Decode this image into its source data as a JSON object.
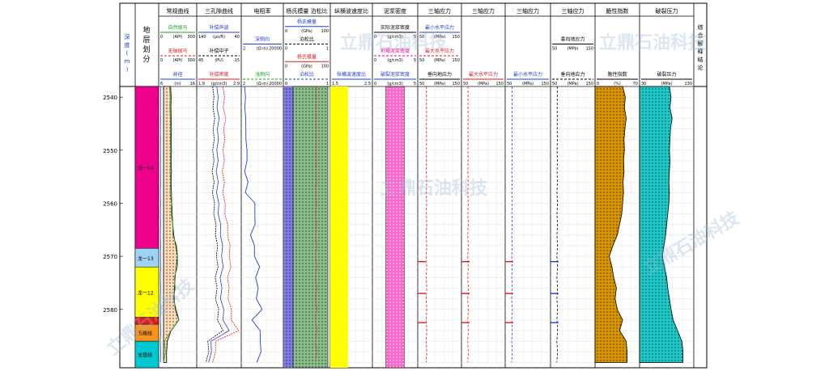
{
  "chart_data": {
    "type": "well-log",
    "depth_track": {
      "title": "深度(m)",
      "ticks": [
        2540,
        2550,
        2560,
        2570,
        2580
      ],
      "ylim": [
        2538,
        2591
      ]
    },
    "zone_track": {
      "title": "地层划分",
      "zones": [
        {
          "name": "龙一14",
          "top": 2538,
          "bottom": 2568.5,
          "color": "#ec008c"
        },
        {
          "name": "龙一13",
          "top": 2568.5,
          "bottom": 2572,
          "color": "#9fd3f5"
        },
        {
          "name": "龙一12",
          "top": 2572,
          "bottom": 2581.5,
          "color": "#ffff00"
        },
        {
          "name": "",
          "top": 2581.5,
          "bottom": 2582.8,
          "color": "#e31a1c"
        },
        {
          "name": "五峰组",
          "top": 2582.8,
          "bottom": 2586,
          "color": "#f7941d"
        },
        {
          "name": "宝塔组",
          "top": 2586,
          "bottom": 2591,
          "color": "#00c8d0"
        }
      ]
    },
    "tracks": [
      {
        "title": "常规曲线",
        "curves": [
          {
            "name": "自然伽马",
            "unit": "(API)",
            "min": "0",
            "max": "300",
            "color": "#2aa02a"
          },
          {
            "name": "无铀伽马",
            "unit": "(API)",
            "min": "0",
            "max": "300",
            "color": "#e31a1c"
          },
          {
            "name": "井径",
            "unit": "(in)",
            "min": "6",
            "max": "16",
            "color": "#1f3fd6"
          }
        ]
      },
      {
        "title": "三孔隙曲线",
        "curves": [
          {
            "name": "补偿声波",
            "unit": "(μs/ft)",
            "min": "140",
            "max": "40",
            "color": "#1f3fd6"
          },
          {
            "name": "补偿中子",
            "unit": "(PU)",
            "min": "45",
            "max": "-15",
            "color": "#000000"
          },
          {
            "name": "补偿密度",
            "unit": "(g/cm3)",
            "min": "1.9",
            "max": "2.9",
            "color": "#e31a1c"
          }
        ]
      },
      {
        "title": "电阻率",
        "curves": [
          {
            "name": "深侧向",
            "unit": "(Ω·m)",
            "min": "2",
            "max": "20000",
            "color": "#1f3fd6"
          },
          {
            "name": "浅侧向",
            "unit": "(Ω·m)",
            "min": "2",
            "max": "20000",
            "color": "#2aa02a"
          }
        ]
      },
      {
        "title": "杨氏模量 泊松比",
        "curves": [
          {
            "name": "杨氏模量",
            "unit": "(GPa)",
            "min": "0",
            "max": "100",
            "color": "#1f3fd6"
          },
          {
            "name": "泊松比",
            "unit": "",
            "min": "0",
            "max": "1",
            "color": "#000000"
          },
          {
            "name": "杨氏模量",
            "unit": "(GPa)",
            "min": "0",
            "max": "100",
            "color": "#e31a1c"
          },
          {
            "name": "泊松比",
            "unit": "",
            "min": "0",
            "max": "1",
            "color": "#1f3fd6"
          }
        ]
      },
      {
        "title": "纵横波速度比",
        "curves": [
          {
            "name": "纵横波速度比",
            "unit": "",
            "min": "1.5",
            "max": "2.5",
            "color": "#1f3fd6"
          }
        ]
      },
      {
        "title": "泥浆密度",
        "curves": [
          {
            "name": "实际泥浆密度",
            "unit": "(g/cm3)",
            "min": "0",
            "max": "5",
            "color": "#000000"
          },
          {
            "name": "坍塌泥浆密度",
            "unit": "(g/cm3)",
            "min": "0",
            "max": "5",
            "color": "#ec008c"
          },
          {
            "name": "破裂泥浆密度",
            "unit": "(g/cm3)",
            "min": "0",
            "max": "5",
            "color": "#1f3fd6"
          }
        ]
      },
      {
        "title": "三轴应力",
        "curves": [
          {
            "name": "最小水平应力",
            "unit": "(MPa)",
            "min": "50",
            "max": "150",
            "color": "#1f3fd6"
          },
          {
            "name": "最大水平应力",
            "unit": "(MPa)",
            "min": "50",
            "max": "150",
            "color": "#e31a1c"
          },
          {
            "name": "垂向地应力",
            "unit": "(MPa)",
            "min": "50",
            "max": "150",
            "color": "#000000"
          }
        ]
      },
      {
        "title": "三轴应力",
        "curves": [
          {
            "name": "最大水平应力",
            "unit": "(MPa)",
            "min": "50",
            "max": "150",
            "color": "#e31a1c"
          }
        ]
      },
      {
        "title": "三轴应力",
        "curves": [
          {
            "name": "最小水平应力",
            "unit": "(MPa)",
            "min": "50",
            "max": "150",
            "color": "#1f3fd6"
          }
        ]
      },
      {
        "title": "三轴应力",
        "curves": [
          {
            "name": "垂向地应力",
            "unit": "(MPa)",
            "min": "50",
            "max": "150",
            "color": "#000000"
          },
          {
            "name": "垂向地应力",
            "unit": "(MPa)",
            "min": "50",
            "max": "150",
            "color": "#000000"
          }
        ]
      },
      {
        "title": "脆性指数",
        "curves": [
          {
            "name": "脆性指数",
            "unit": "(%)",
            "min": "0",
            "max": "70",
            "color": "#000000"
          }
        ]
      },
      {
        "title": "破裂压力",
        "curves": [
          {
            "name": "破裂压力",
            "unit": "(MPa)",
            "min": "30",
            "max": "130",
            "color": "#000000"
          }
        ]
      },
      {
        "title": "综合解释结论",
        "curves": []
      }
    ],
    "samples": {
      "depth": [
        2538,
        2540,
        2542,
        2544,
        2546,
        2548,
        2550,
        2552,
        2554,
        2556,
        2558,
        2560,
        2562,
        2564,
        2566,
        2568,
        2570,
        2572,
        2574,
        2576,
        2578,
        2580,
        2582,
        2584,
        2586,
        2588,
        2590
      ],
      "gr": [
        0.28,
        0.3,
        0.29,
        0.3,
        0.31,
        0.3,
        0.31,
        0.3,
        0.31,
        0.3,
        0.31,
        0.32,
        0.34,
        0.36,
        0.4,
        0.48,
        0.55,
        0.5,
        0.45,
        0.43,
        0.42,
        0.46,
        0.6,
        0.3,
        0.15,
        0.12,
        0.12
      ],
      "dt": [
        0.45,
        0.48,
        0.46,
        0.5,
        0.47,
        0.48,
        0.46,
        0.47,
        0.45,
        0.47,
        0.46,
        0.48,
        0.5,
        0.52,
        0.55,
        0.56,
        0.58,
        0.57,
        0.55,
        0.54,
        0.56,
        0.58,
        0.62,
        0.7,
        0.35,
        0.3,
        0.3
      ],
      "rd": [
        0.08,
        0.1,
        0.09,
        0.1,
        0.12,
        0.1,
        0.15,
        0.12,
        0.1,
        0.14,
        0.12,
        0.3,
        0.35,
        0.3,
        0.25,
        0.28,
        0.35,
        0.4,
        0.38,
        0.36,
        0.4,
        0.45,
        0.3,
        0.4,
        0.5,
        0.42,
        0.42
      ],
      "brittle": [
        0.62,
        0.68,
        0.66,
        0.7,
        0.67,
        0.65,
        0.66,
        0.64,
        0.65,
        0.63,
        0.64,
        0.62,
        0.6,
        0.55,
        0.5,
        0.4,
        0.32,
        0.38,
        0.42,
        0.48,
        0.45,
        0.5,
        0.62,
        0.55,
        0.7,
        0.72,
        0.72
      ],
      "frac": [
        0.55,
        0.58,
        0.56,
        0.6,
        0.57,
        0.56,
        0.55,
        0.56,
        0.55,
        0.54,
        0.55,
        0.54,
        0.52,
        0.5,
        0.48,
        0.45,
        0.42,
        0.46,
        0.5,
        0.52,
        0.55,
        0.58,
        0.62,
        0.7,
        0.78,
        0.8,
        0.8
      ]
    },
    "stress_markers": [
      2571,
      2577,
      2582.5
    ]
  },
  "colors": {
    "fill_ym": "#7d7ddc",
    "fill_pr": "#8dbb8d",
    "fill_vpvs": "#ffff00",
    "fill_mud": "#ff66cc",
    "fill_brittle": "#d99500",
    "fill_frac": "#20c8c8"
  },
  "watermark": "立鼎石油科技"
}
